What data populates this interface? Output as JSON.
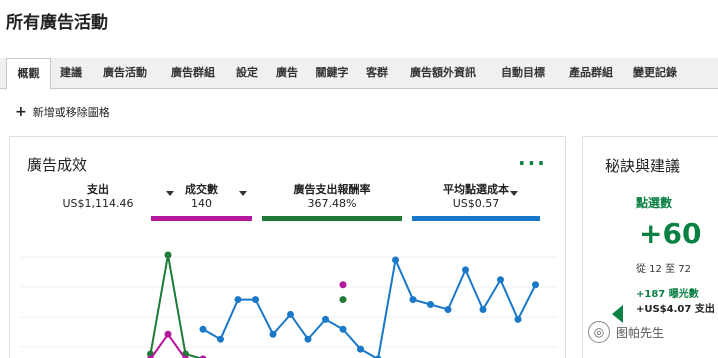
{
  "page": {
    "title": "所有廣告活動"
  },
  "tabs": [
    {
      "label": "概觀",
      "active": true
    },
    {
      "label": "建議"
    },
    {
      "label": "廣告活動"
    },
    {
      "label": "廣告群組"
    },
    {
      "label": "設定"
    },
    {
      "label": "廣告"
    },
    {
      "label": "關鍵字"
    },
    {
      "label": "客群"
    },
    {
      "label": "廣告額外資訊"
    },
    {
      "label": "自動目標"
    },
    {
      "label": "產品群組"
    },
    {
      "label": "變更記錄"
    }
  ],
  "toolbar": {
    "add_remove_label": "新增或移除圖格"
  },
  "performance_card": {
    "title": "廣告成效",
    "metrics": [
      {
        "label": "支出",
        "value": "US$1,114.46",
        "color": "#ffffff"
      },
      {
        "label": "成交數",
        "value": "140",
        "color": "#b5179e"
      },
      {
        "label": "廣告支出報酬率",
        "value": "367.48%",
        "color": "#1e7b35"
      },
      {
        "label": "平均點選成本",
        "value": "US$0.57",
        "color": "#1a78c8"
      }
    ]
  },
  "chart_data": {
    "type": "line",
    "x": [
      1,
      2,
      3,
      4,
      5,
      6,
      7,
      8,
      9,
      10,
      11,
      12,
      13,
      14,
      15,
      16,
      17,
      18,
      19,
      20,
      21,
      22,
      23,
      24,
      25,
      26,
      27,
      28,
      29,
      30
    ],
    "series": [
      {
        "name": "廣告支出報酬率",
        "color": "#1e7b35",
        "values": [
          null,
          null,
          null,
          null,
          null,
          null,
          null,
          5,
          105,
          5,
          0,
          null,
          null,
          null,
          null,
          null,
          null,
          null,
          60,
          null,
          null,
          null,
          null,
          null,
          null,
          null,
          null,
          null,
          null,
          null
        ]
      },
      {
        "name": "成交數",
        "color": "#b5179e",
        "values": [
          null,
          null,
          null,
          null,
          null,
          null,
          null,
          0,
          25,
          0,
          0,
          null,
          null,
          null,
          null,
          null,
          null,
          null,
          75,
          null,
          null,
          null,
          null,
          null,
          null,
          null,
          null,
          null,
          null,
          null
        ]
      },
      {
        "name": "平均點選成本",
        "color": "#1a78c8",
        "values": [
          null,
          null,
          null,
          null,
          null,
          null,
          null,
          null,
          null,
          null,
          30,
          20,
          60,
          60,
          25,
          45,
          20,
          40,
          30,
          10,
          0,
          100,
          60,
          55,
          50,
          90,
          50,
          80,
          40,
          75
        ]
      }
    ]
  },
  "tips_card": {
    "title": "秘訣與建議",
    "metric_label": "點選數",
    "metric_change": "+60",
    "from_to": "從 12 至 72",
    "line1": "+187 曝光數",
    "line2": "+US$4.07 支出"
  },
  "watermark": {
    "text": "图帕先生"
  },
  "colors": {
    "accent": "#0b8043"
  }
}
